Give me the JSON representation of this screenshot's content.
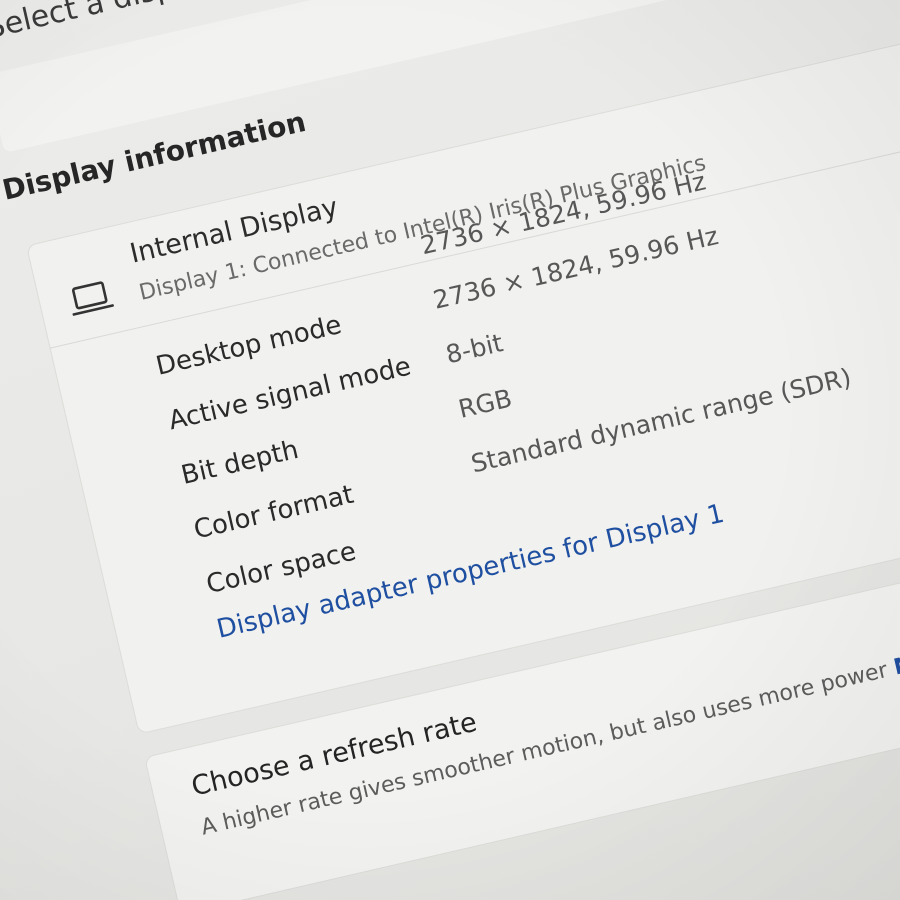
{
  "header": {
    "select_prompt": "Select a display to change its settings"
  },
  "display_information": {
    "section_title": "Display information",
    "display": {
      "icon": "laptop-icon",
      "name": "Internal Display",
      "connection": "Display 1: Connected to Intel(R) Iris(R) Plus Graphics"
    },
    "rows": [
      {
        "label": "Desktop mode",
        "value": "2736 × 1824, 59.96 Hz"
      },
      {
        "label": "Active signal mode",
        "value": "2736 × 1824, 59.96 Hz"
      },
      {
        "label": "Bit depth",
        "value": "8-bit"
      },
      {
        "label": "Color format",
        "value": "RGB"
      },
      {
        "label": "Color space",
        "value": "Standard dynamic range (SDR)"
      }
    ],
    "adapter_link": "Display adapter properties for Display 1"
  },
  "refresh_rate": {
    "title": "Choose a refresh rate",
    "description": "A higher rate gives smoother motion, but also uses more power",
    "more_link": "More about refresh rate"
  },
  "colors": {
    "link": "#1f4fa0",
    "card_background": "#f1f1ef",
    "page_background": "#e9e9e7"
  }
}
